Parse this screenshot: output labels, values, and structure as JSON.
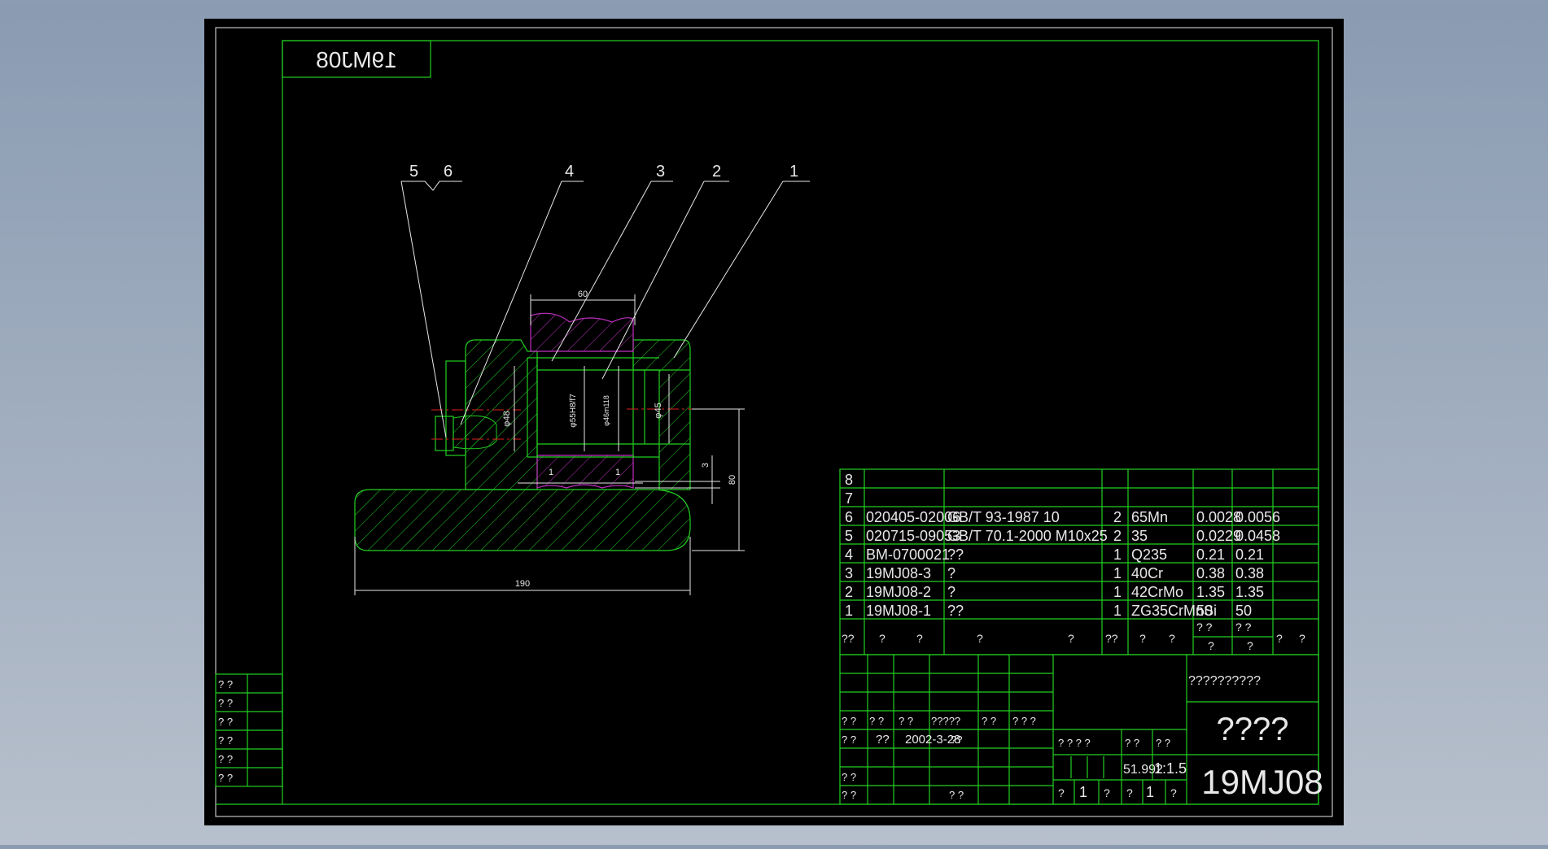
{
  "drawing": {
    "title_mirrored": "19MJ08",
    "colors": {
      "frame": "#22d022",
      "dim": "#e8e8e8",
      "hatch_magenta": "#c030c0",
      "center": "#e02020",
      "paper": "#000000"
    },
    "leaders": [
      "5",
      "6",
      "4",
      "3",
      "2",
      "1"
    ],
    "dims": {
      "top": "60",
      "bottom": "190",
      "right": "80",
      "small": "3",
      "gap1": "1",
      "gap2": "1",
      "d1": "φ48",
      "d2": "φ55H8/f7",
      "d3": "φ46m118",
      "d4": "φ45"
    },
    "left_strip": [
      "? ?",
      "? ?",
      "? ?",
      "? ?",
      "? ?",
      "? ?"
    ],
    "bom": [
      {
        "no": "8",
        "code": "",
        "name": "",
        "qty": "",
        "mat": "",
        "w1": "",
        "w2": ""
      },
      {
        "no": "7",
        "code": "",
        "name": "",
        "qty": "",
        "mat": "",
        "w1": "",
        "w2": ""
      },
      {
        "no": "6",
        "code": "020405-02006",
        "name": "GB/T  93-1987  10",
        "qty": "2",
        "mat": "65Mn",
        "w1": "0.0028",
        "w2": "0.0056"
      },
      {
        "no": "5",
        "code": "020715-09053",
        "name": "GB/T  70.1-2000  M10x25",
        "qty": "2",
        "mat": "35",
        "w1": "0.0229",
        "w2": "0.0458"
      },
      {
        "no": "4",
        "code": "BM-0700021",
        "name": "??",
        "qty": "1",
        "mat": "Q235",
        "w1": "0.21",
        "w2": "0.21"
      },
      {
        "no": "3",
        "code": "19MJ08-3",
        "name": "?",
        "qty": "1",
        "mat": "40Cr",
        "w1": "0.38",
        "w2": "0.38"
      },
      {
        "no": "2",
        "code": "19MJ08-2",
        "name": "?",
        "qty": "1",
        "mat": "42CrMo",
        "w1": "1.35",
        "w2": "1.35"
      },
      {
        "no": "1",
        "code": "19MJ08-1",
        "name": "??",
        "qty": "1",
        "mat": "ZG35CrMnSi",
        "w1": "50",
        "w2": "50"
      }
    ],
    "bom_header": [
      "??",
      "?",
      "?",
      "?",
      "?",
      "??",
      "?",
      "?",
      "? ?",
      "? ?",
      "?",
      "?",
      "?",
      "?"
    ],
    "title_block": {
      "sign_row": [
        "? ?",
        "? ?",
        "? ?",
        "?????",
        "? ?",
        "? ? ?"
      ],
      "date_row": [
        "? ?",
        "??",
        "2002-3-28",
        "??"
      ],
      "row3": [
        "? ?"
      ],
      "row4": [
        "? ?",
        "? ?"
      ],
      "stage_label": "? ? ? ?",
      "weight_label": "? ?",
      "scale_label": "? ?",
      "weight": "51.992",
      "scale": "1:1.5",
      "sheet": [
        "?",
        "1",
        "?",
        "?",
        "1",
        "?"
      ],
      "company": "??????????",
      "part_name": "????",
      "drawing_no": "19MJ08"
    }
  }
}
